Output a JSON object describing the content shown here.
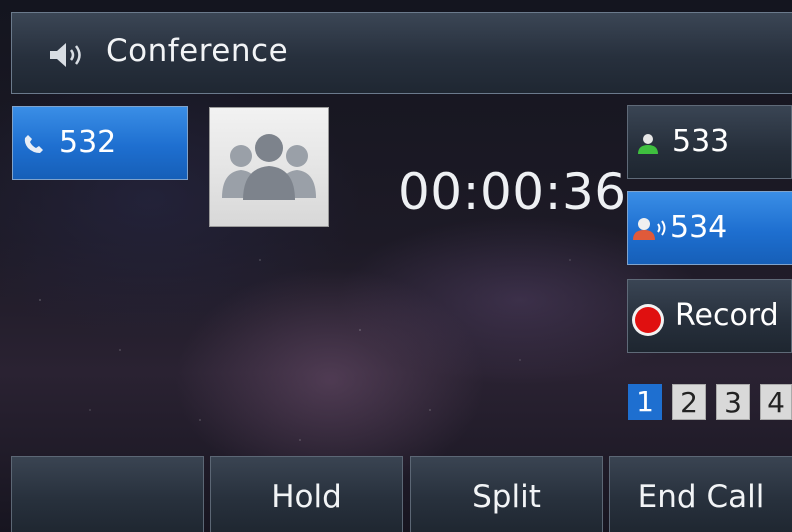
{
  "header": {
    "title": "Conference",
    "icon": "speaker-icon"
  },
  "lines": {
    "local": {
      "label": "532",
      "icon": "phone-handset-icon",
      "color": "#1e6fd0"
    },
    "participants": [
      {
        "label": "533",
        "icon": "contact-icon",
        "status_color": "#3fbf3f"
      },
      {
        "label": "534",
        "icon": "contact-speaking-icon",
        "status_color": "#e05a3a"
      }
    ],
    "record": {
      "label": "Record",
      "icon": "record-dot-icon",
      "color": "#e01010"
    }
  },
  "call": {
    "timer": "00:00:36",
    "avatar": "group-avatar-icon"
  },
  "pagination": {
    "pages": [
      "1",
      "2",
      "3",
      "4"
    ],
    "active": "1"
  },
  "softkeys": [
    "",
    "Hold",
    "Split",
    "End Call"
  ],
  "colors": {
    "accent_blue": "#1e6fd0",
    "panel_dark": "#27303d"
  }
}
